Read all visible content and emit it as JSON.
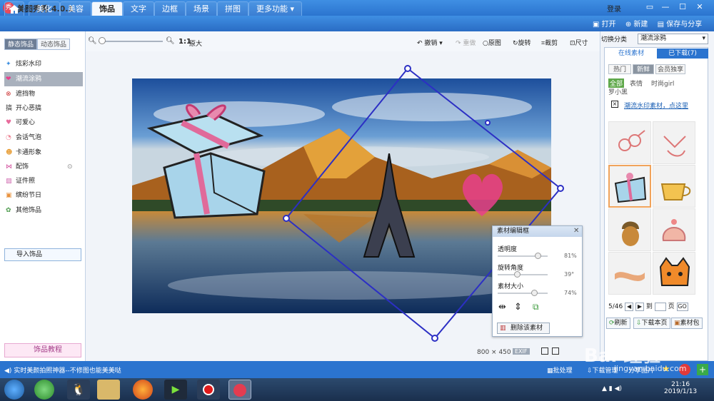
{
  "app": {
    "title": "美图秀秀 4.0.1",
    "logo": "秀",
    "login": "登录"
  },
  "window_buttons": [
    "▭",
    "—",
    "☐",
    "✕"
  ],
  "menu": {
    "tabs": [
      "美化",
      "美容",
      "饰品",
      "文字",
      "边框",
      "场景",
      "拼图",
      "更多功能 ▾"
    ],
    "active": "饰品",
    "actions": {
      "open": "打开",
      "new": "新建",
      "save": "保存与分享"
    }
  },
  "toolbar": {
    "ratio": "1:1",
    "original_size": "原大",
    "undo": "撤销",
    "redo": "重做",
    "original": "原图",
    "rotate": "旋转",
    "crop": "裁剪",
    "resize": "尺寸"
  },
  "left_panel": {
    "tabs": [
      "静态饰品",
      "动态饰品"
    ],
    "categories": [
      {
        "label": "炫彩水印",
        "icon": "sparkle-icon"
      },
      {
        "label": "潮流涂鸦",
        "icon": "heart-icon"
      },
      {
        "label": "遮挡物",
        "icon": "mask-icon"
      },
      {
        "label": "开心恶搞",
        "icon": "funny-icon"
      },
      {
        "label": "可爱心",
        "icon": "heart-icon"
      },
      {
        "label": "会话气泡",
        "icon": "bubble-icon"
      },
      {
        "label": "卡通形象",
        "icon": "cartoon-icon"
      },
      {
        "label": "配饰",
        "icon": "bow-icon"
      },
      {
        "label": "证件照",
        "icon": "id-photo-icon"
      },
      {
        "label": "缤纷节日",
        "icon": "gift-icon"
      },
      {
        "label": "其他饰品",
        "icon": "flower-icon"
      }
    ],
    "active_category": "潮流涂鸦",
    "import": "导入饰品",
    "tutorial": "饰品教程"
  },
  "canvas": {
    "width": "800",
    "height": "450",
    "exif": "EXIF"
  },
  "editor": {
    "title": "素材编辑框",
    "opacity_label": "透明度",
    "opacity_value": "81%",
    "opacity": 0.81,
    "rotation_label": "旋转角度",
    "rotation_value": "39°",
    "rotation": 0.39,
    "size_label": "素材大小",
    "size_value": "74%",
    "size": 0.74,
    "delete": "删除该素材"
  },
  "right_panel": {
    "category_label": "切换分类",
    "category_value": "潮流涂鸦",
    "tabs": [
      "在线素材",
      "已下载(7)"
    ],
    "filters": [
      "热门",
      "新鲜",
      "会员独享"
    ],
    "subfilters": [
      "全部",
      "表情",
      "时尚girl",
      "罗小黑"
    ],
    "notice": "潮流水印素材，点这里",
    "page": "5/46",
    "goto_prefix": "到",
    "goto_suffix": "页",
    "go": "GO",
    "refresh": "刷新",
    "download_page": "下载本页",
    "material_pack": "素材包"
  },
  "status": {
    "message": "实时美颜拍照神器--不修图也能美美哒",
    "batch": "批处理",
    "download_mgr": "下载管理",
    "share": "分享图片"
  },
  "taskbar": {
    "time": "21:16",
    "date": "2019/1/13"
  },
  "watermark": {
    "text": "Bai 经验",
    "url": "jingyan.baidu.com"
  },
  "colors": {
    "accent": "#2b74cf",
    "selected_thumb": "#f0a35b",
    "active_category": "#a9b1bd",
    "tutorial": "#fde8f5"
  }
}
